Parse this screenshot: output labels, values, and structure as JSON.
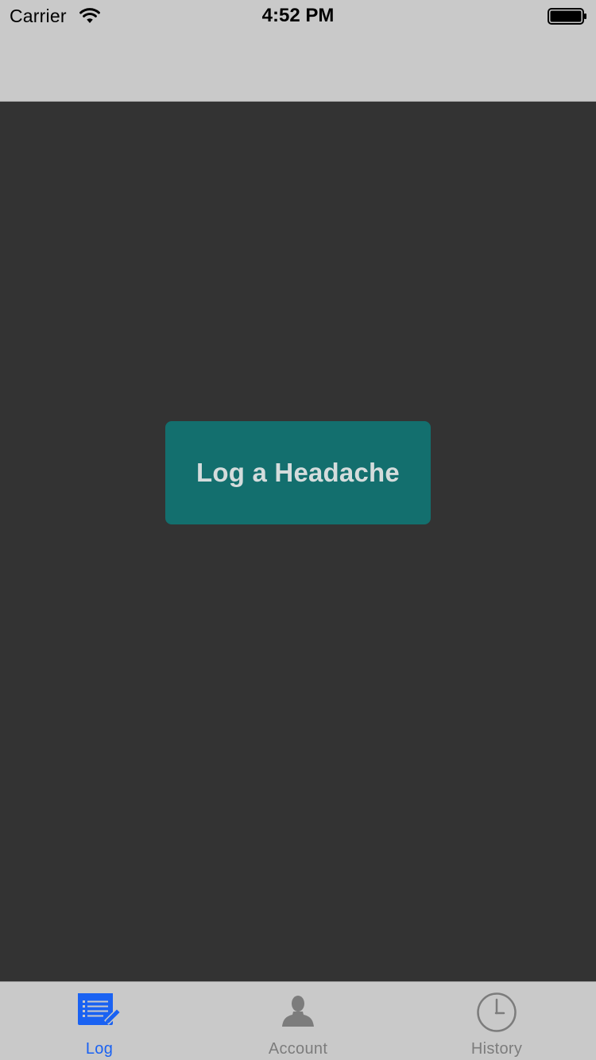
{
  "status_bar": {
    "carrier": "Carrier",
    "time": "4:52 PM",
    "wifi_icon": "wifi-icon",
    "battery_icon": "battery-full-icon"
  },
  "navigation_bar": {
    "title": ""
  },
  "main": {
    "action_button_label": "Log a Headache"
  },
  "tab_bar": {
    "tabs": [
      {
        "label": "Log",
        "icon": "log-list-icon",
        "selected": true
      },
      {
        "label": "Account",
        "icon": "account-person-icon",
        "selected": false
      },
      {
        "label": "History",
        "icon": "history-clock-icon",
        "selected": false
      }
    ]
  },
  "colors": {
    "background": "#333333",
    "bars": "#c9c9c9",
    "button": "#136f6e",
    "button_text": "#d4dcdc",
    "tab_active": "#1a62f2",
    "tab_inactive": "#7c7c7c"
  }
}
